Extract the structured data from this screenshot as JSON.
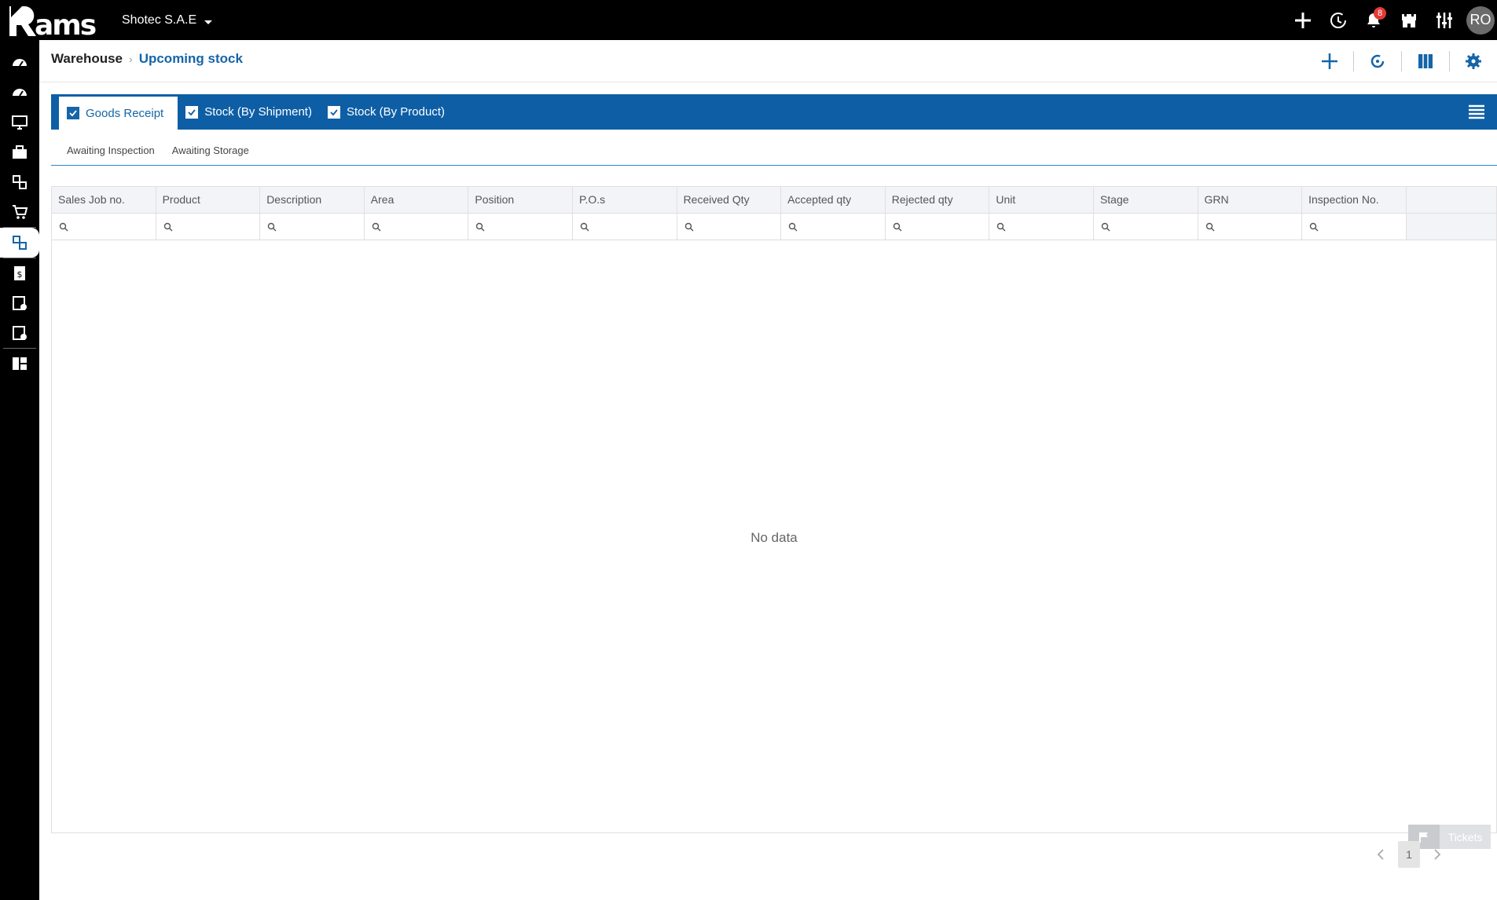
{
  "app": {
    "logo_text": "?ams",
    "company": "Shotec S.A.E",
    "notifications_count": "8",
    "user_initials": "RO"
  },
  "breadcrumb": {
    "root": "Warehouse",
    "current": "Upcoming stock"
  },
  "tabs": [
    {
      "label": "Goods Receipt",
      "active": true
    },
    {
      "label": "Stock (By Shipment)",
      "active": false
    },
    {
      "label": "Stock (By Product)",
      "active": false
    }
  ],
  "subtabs": [
    "Awaiting Inspection",
    "Awaiting Storage"
  ],
  "grid": {
    "columns": [
      "Sales Job no.",
      "Product",
      "Description",
      "Area",
      "Position",
      "P.O.s",
      "Received Qty",
      "Accepted qty",
      "Rejected qty",
      "Unit",
      "Stage",
      "GRN",
      "Inspection No."
    ],
    "empty_text": "No data"
  },
  "pager": {
    "current_page": "1"
  },
  "tickets_label": "Tickets",
  "colors": {
    "accent": "#0e5ea6",
    "link": "#1565a8",
    "badge": "#e53935"
  }
}
